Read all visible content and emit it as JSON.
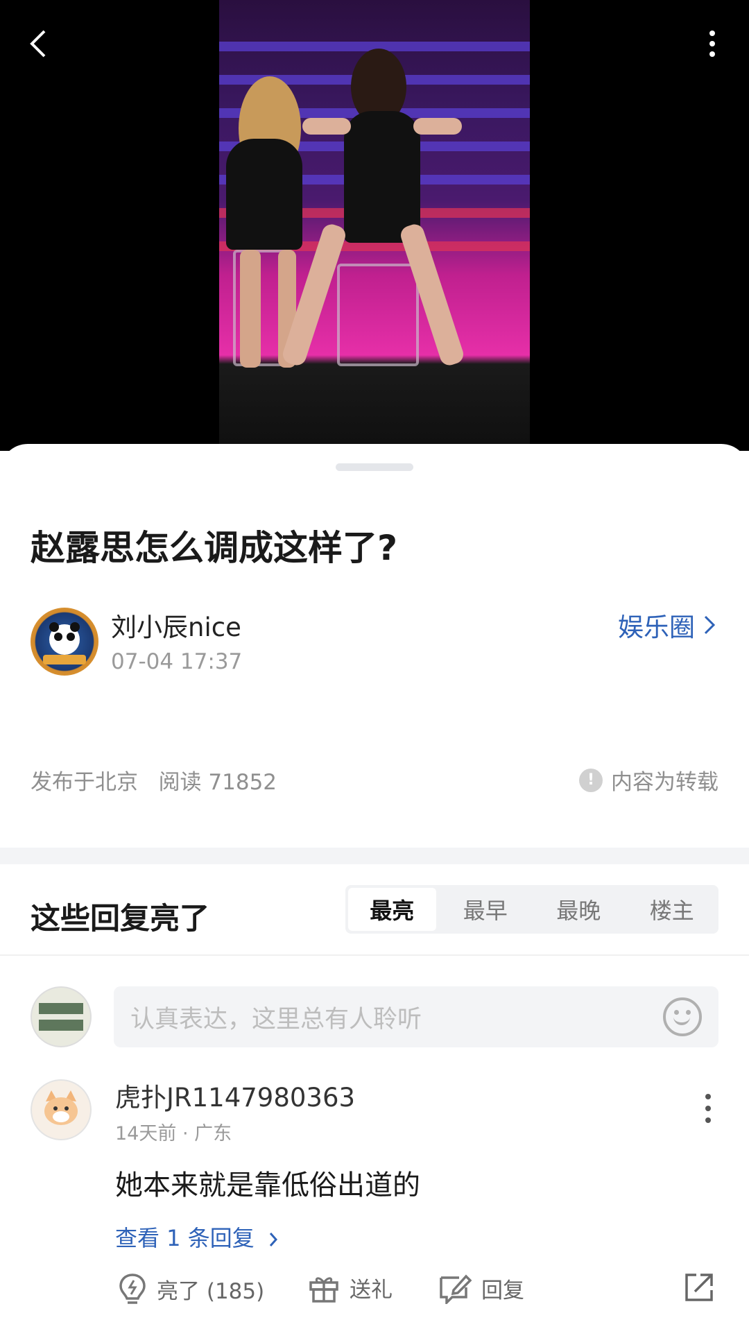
{
  "header": {
    "back_icon": "chevron-left-icon",
    "more_icon": "vertical-dots-icon"
  },
  "post": {
    "title": "赵露思怎么调成这样了?",
    "author": "刘小辰nice",
    "time": "07-04 17:37",
    "circle": "娱乐圈",
    "location": "发布于北京",
    "reads": "阅读 71852",
    "repost_note": "内容为转载"
  },
  "replies_section": {
    "title": "这些回复亮了",
    "tabs": [
      "最亮",
      "最早",
      "最晚",
      "楼主"
    ],
    "active_tab": 0
  },
  "composer": {
    "placeholder": "认真表达，这里总有人聆听"
  },
  "comment": {
    "user": "虎扑JR1147980363",
    "meta": "14天前 · 广东",
    "text": "她本来就是靠低俗出道的",
    "replies_link": "查看 1 条回复",
    "like_label": "亮了 (185)",
    "gift_label": "送礼",
    "reply_label": "回复"
  },
  "colors": {
    "accent_blue": "#2e62b8",
    "muted": "#8f8f8f"
  }
}
